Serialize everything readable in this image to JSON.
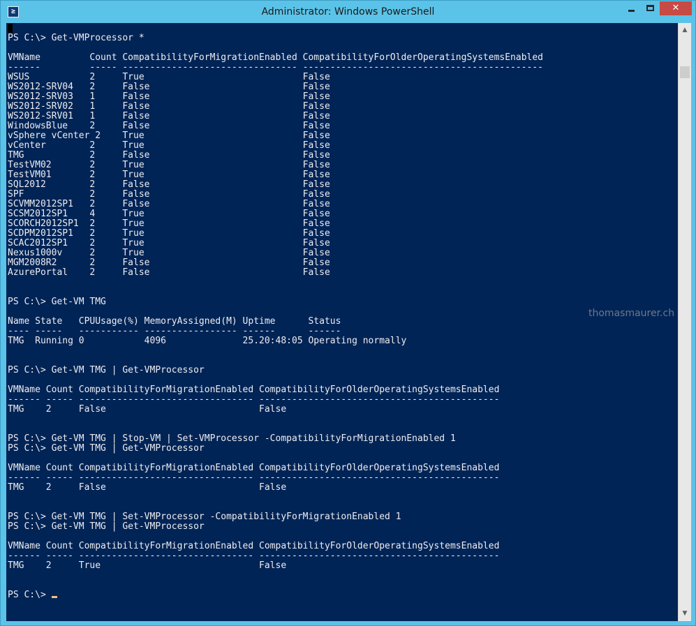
{
  "window": {
    "title": "Administrator: Windows PowerShell",
    "icon": "powershell-icon",
    "icon_glyph": "≥",
    "buttons": {
      "minimize": "minimize-icon",
      "maximize": "maximize-icon",
      "close": "close-icon",
      "close_glyph": "✕"
    },
    "colors": {
      "titlebar": "#5bc3e8",
      "console_background": "#012456",
      "console_text": "#eeedf0",
      "close_button": "#c74a44"
    }
  },
  "console": {
    "lines": [
      "",
      "PS C:\\> Get-VMProcessor *",
      "",
      "VMName         Count CompatibilityForMigrationEnabled CompatibilityForOlderOperatingSystemsEnabled",
      "------         ----- -------------------------------- --------------------------------------------",
      "WSUS           2     True                             False",
      "WS2012-SRV04   2     False                            False",
      "WS2012-SRV03   1     False                            False",
      "WS2012-SRV02   1     False                            False",
      "WS2012-SRV01   1     False                            False",
      "WindowsBlue    2     False                            False",
      "vSphere vCenter 2    True                             False",
      "vCenter        2     True                             False",
      "TMG            2     False                            False",
      "TestVM02       2     True                             False",
      "TestVM01       2     True                             False",
      "SQL2012        2     False                            False",
      "SPF            2     False                            False",
      "SCVMM2012SP1   2     False                            False",
      "SCSM2012SP1    4     True                             False",
      "SCORCH2012SP1  2     True                             False",
      "SCDPM2012SP1   2     True                             False",
      "SCAC2012SP1    2     True                             False",
      "Nexus1000v     2     True                             False",
      "MGM2008R2      2     False                            False",
      "AzurePortal    2     False                            False",
      "",
      "",
      "PS C:\\> Get-VM TMG",
      "",
      "Name State   CPUUsage(%) MemoryAssigned(M) Uptime      Status",
      "---- -----   ----------- ----------------- ------      ------",
      "TMG  Running 0           4096              25.20:48:05 Operating normally",
      "",
      "",
      "PS C:\\> Get-VM TMG | Get-VMProcessor",
      "",
      "VMName Count CompatibilityForMigrationEnabled CompatibilityForOlderOperatingSystemsEnabled",
      "------ ----- -------------------------------- --------------------------------------------",
      "TMG    2     False                            False",
      "",
      "",
      "PS C:\\> Get-VM TMG | Stop-VM | Set-VMProcessor -CompatibilityForMigrationEnabled 1",
      "PS C:\\> Get-VM TMG | Get-VMProcessor",
      "",
      "VMName Count CompatibilityForMigrationEnabled CompatibilityForOlderOperatingSystemsEnabled",
      "------ ----- -------------------------------- --------------------------------------------",
      "TMG    2     False                            False",
      "",
      "",
      "PS C:\\> Get-VM TMG | Set-VMProcessor -CompatibilityForMigrationEnabled 1",
      "PS C:\\> Get-VM TMG | Get-VMProcessor",
      "",
      "VMName Count CompatibilityForMigrationEnabled CompatibilityForOlderOperatingSystemsEnabled",
      "------ ----- -------------------------------- --------------------------------------------",
      "TMG    2     True                             False",
      "",
      "",
      "PS C:\\> "
    ],
    "watermark": "thomasmaurer.ch"
  },
  "scrollbar": {
    "up_icon": "scroll-up-arrow-icon",
    "down_icon": "scroll-down-arrow-icon",
    "up_glyph": "▲",
    "down_glyph": "▼"
  }
}
